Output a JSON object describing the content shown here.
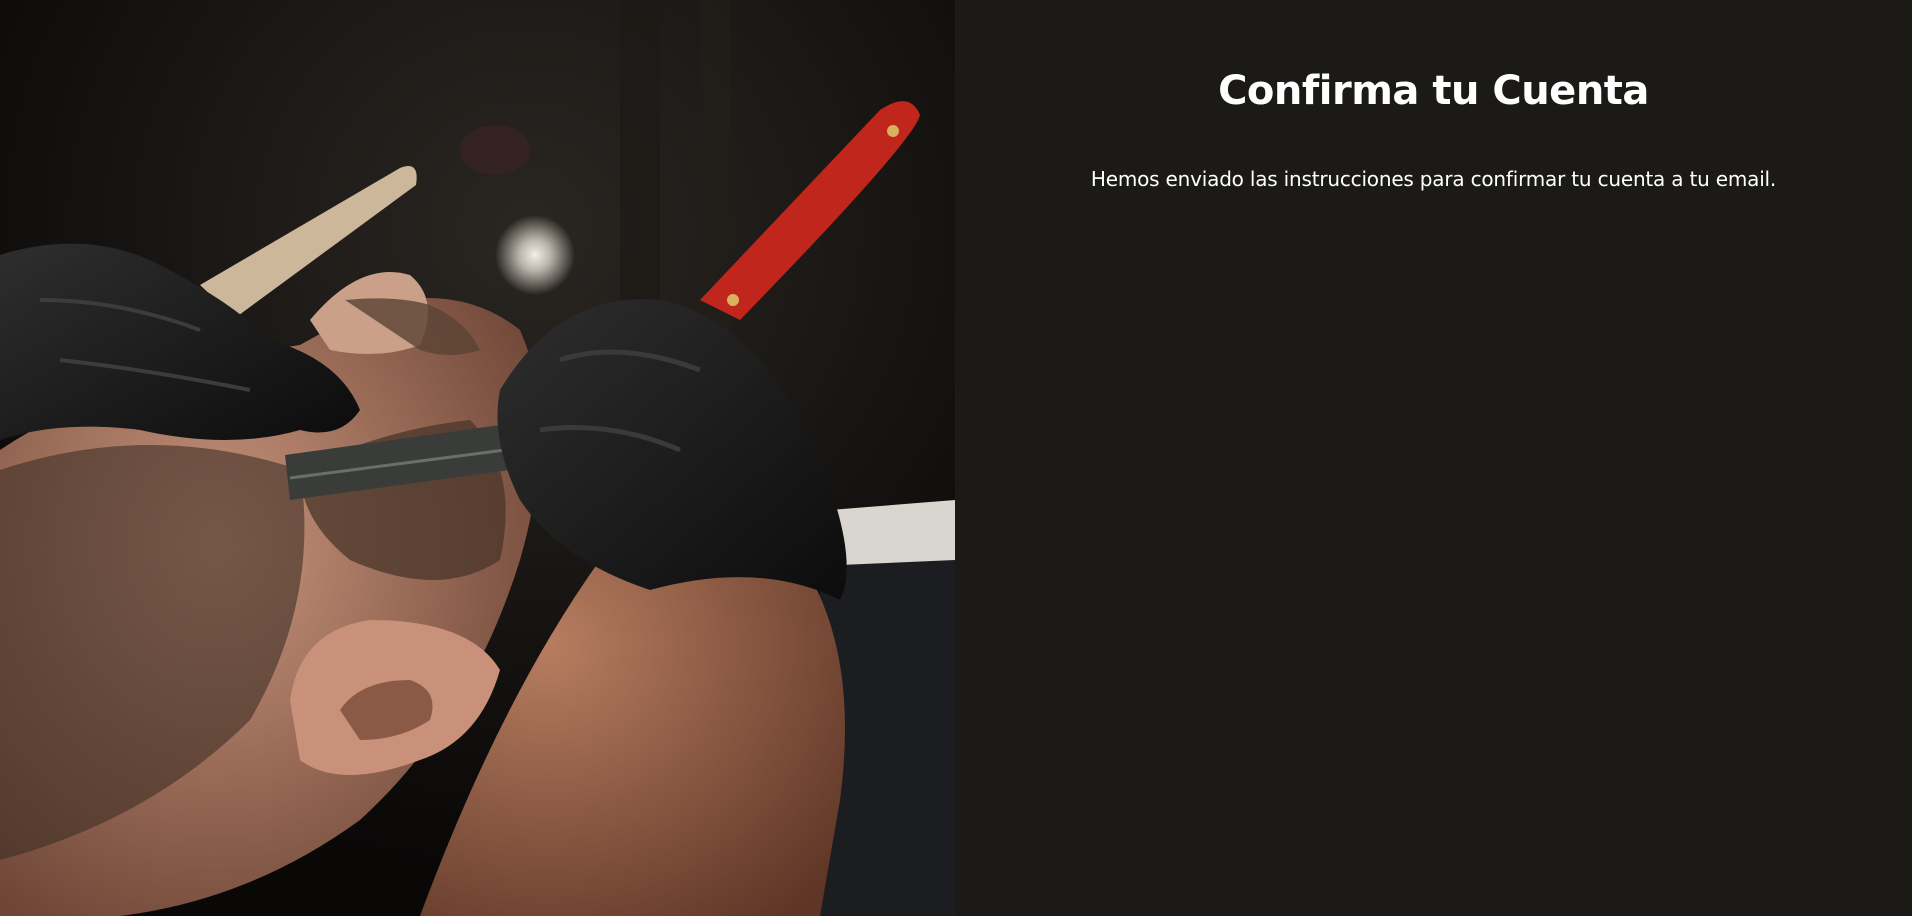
{
  "hero": {
    "image_icon": "barber-shave-photo"
  },
  "confirm": {
    "title": "Confirma tu Cuenta",
    "message": "Hemos enviado las instrucciones para confirmar tu cuenta a tu email."
  },
  "colors": {
    "panel_background": "#1b1a16",
    "text": "#ffffff",
    "razor_handle": "#c0261b",
    "glove": "#141414"
  }
}
